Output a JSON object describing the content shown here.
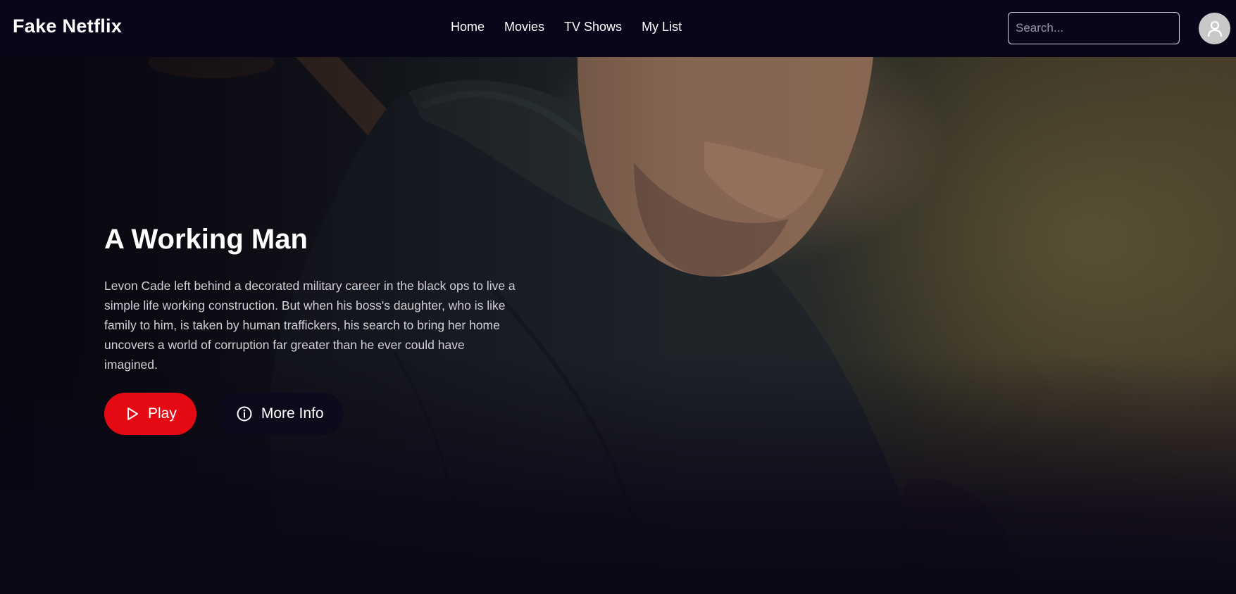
{
  "app": {
    "logo": "Fake Netflix"
  },
  "nav": {
    "links": [
      "Home",
      "Movies",
      "TV Shows",
      "My List"
    ]
  },
  "search": {
    "placeholder": "Search...",
    "value": ""
  },
  "profile": {
    "icon": "user-icon"
  },
  "hero": {
    "title": "A Working Man",
    "description": "Levon Cade left behind a decorated military career in the black ops to live a simple life working construction. But when his boss's daughter, who is like family to him, is taken by human traffickers, his search to bring her home uncovers a world of corruption far greater than he ever could have imagined.",
    "play_label": "Play",
    "play_icon": "play-icon",
    "info_label": "More Info",
    "info_icon": "info-icon"
  },
  "colors": {
    "background": "#0b0717",
    "navbar": "#0a061a",
    "accent": "#e50914",
    "info_button": "#0e0a1c"
  }
}
